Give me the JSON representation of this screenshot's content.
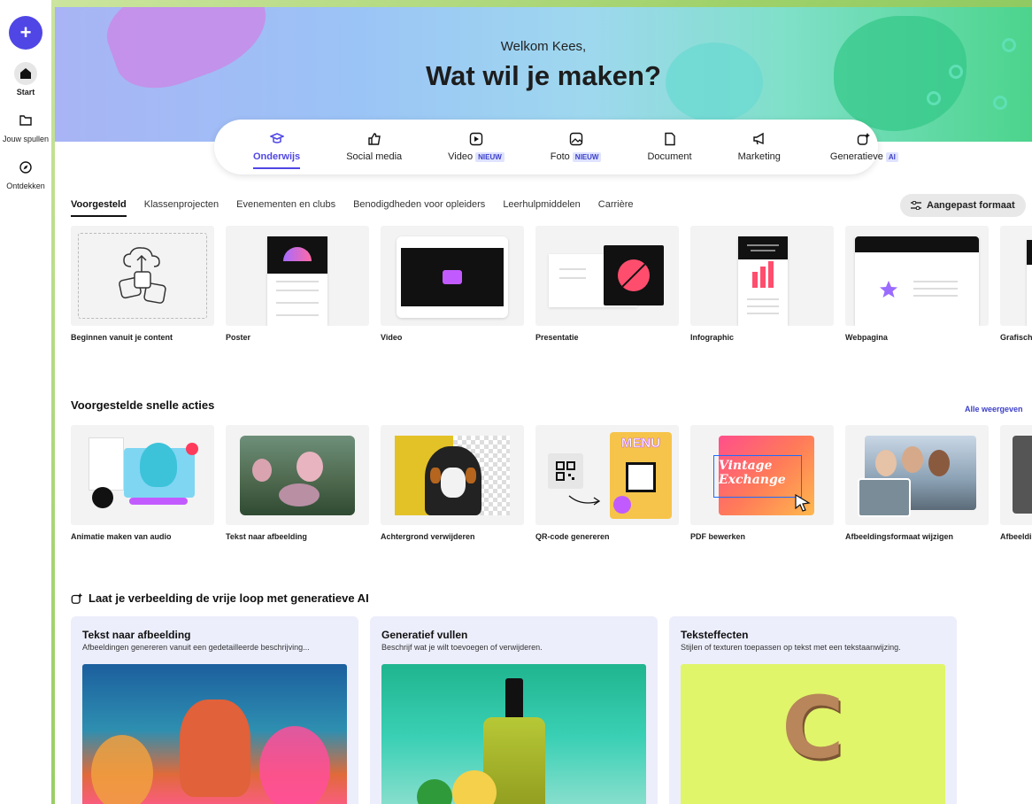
{
  "rail": {
    "new_label": "+",
    "items": [
      {
        "label": "Start"
      },
      {
        "label": "Jouw spullen"
      },
      {
        "label": "Ontdekken"
      }
    ]
  },
  "hero": {
    "welcome": "Welkom Kees,",
    "headline": "Wat wil je maken?"
  },
  "categories": [
    {
      "label": "Onderwijs",
      "icon": "graduation-cap-icon"
    },
    {
      "label": "Social media",
      "icon": "thumbs-up-icon"
    },
    {
      "label": "Video",
      "badge": "NIEUW",
      "icon": "play-icon"
    },
    {
      "label": "Foto",
      "badge": "NIEUW",
      "icon": "image-icon"
    },
    {
      "label": "Document",
      "icon": "document-icon"
    },
    {
      "label": "Marketing",
      "icon": "megaphone-icon"
    },
    {
      "label": "Generatieve",
      "badge": "AI",
      "icon": "sparkle-icon"
    }
  ],
  "subtabs": [
    "Voorgesteld",
    "Klassenprojecten",
    "Evenementen en clubs",
    "Benodigdheden voor opleiders",
    "Leerhulpmiddelen",
    "Carrière"
  ],
  "custom_size_label": "Aangepast formaat",
  "templates": [
    "Beginnen vanuit je content",
    "Poster",
    "Video",
    "Presentatie",
    "Infographic",
    "Webpagina",
    "Grafisch"
  ],
  "quick_actions": {
    "title": "Voorgestelde snelle acties",
    "see_all": "Alle weergeven",
    "items": [
      "Animatie maken van audio",
      "Tekst naar afbeelding",
      "Achtergrond verwijderen",
      "QR-code genereren",
      "PDF bewerken",
      "Afbeeldingsformaat wijzigen",
      "Afbeeldi"
    ],
    "pdf_edit_text": "Vintage Exchange",
    "qr_menu_text": "MENU"
  },
  "genai": {
    "title": "Laat je verbeelding de vrije loop met generatieve AI",
    "cards": [
      {
        "title": "Tekst naar afbeelding",
        "desc": "Afbeeldingen genereren vanuit een gedetailleerde beschrijving..."
      },
      {
        "title": "Generatief vullen",
        "desc": "Beschrijf wat je wilt toevoegen of verwijderen."
      },
      {
        "title": "Teksteffecten",
        "desc": "Stijlen of texturen toepassen op tekst met een tekstaanwijzing.",
        "letter": "C"
      }
    ]
  },
  "colors": {
    "accent": "#4f46e5",
    "link": "#3b3fc9"
  }
}
